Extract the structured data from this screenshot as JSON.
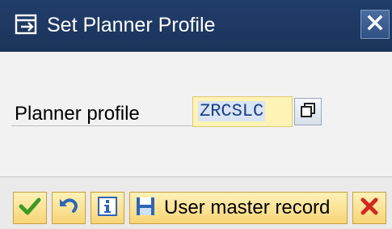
{
  "dialog": {
    "title": "Set Planner Profile",
    "title_icon": "dialog-window-icon",
    "close_icon": "close-icon"
  },
  "form": {
    "planner_profile_label": "Planner profile",
    "planner_profile_value": "ZRCSLC",
    "value_help_icon": "copy-icon"
  },
  "footer": {
    "user_master_record_label": "User master record",
    "icons": [
      "checkmark-icon",
      "undo-icon",
      "info-icon",
      "save-icon",
      "cancel-icon"
    ]
  },
  "colors": {
    "titlebar": "#1e3a66",
    "input_bg": "#fff3b5",
    "button_bg": "#f9db80",
    "cancel_red": "#d2281f",
    "ok_green": "#4aa52e"
  }
}
